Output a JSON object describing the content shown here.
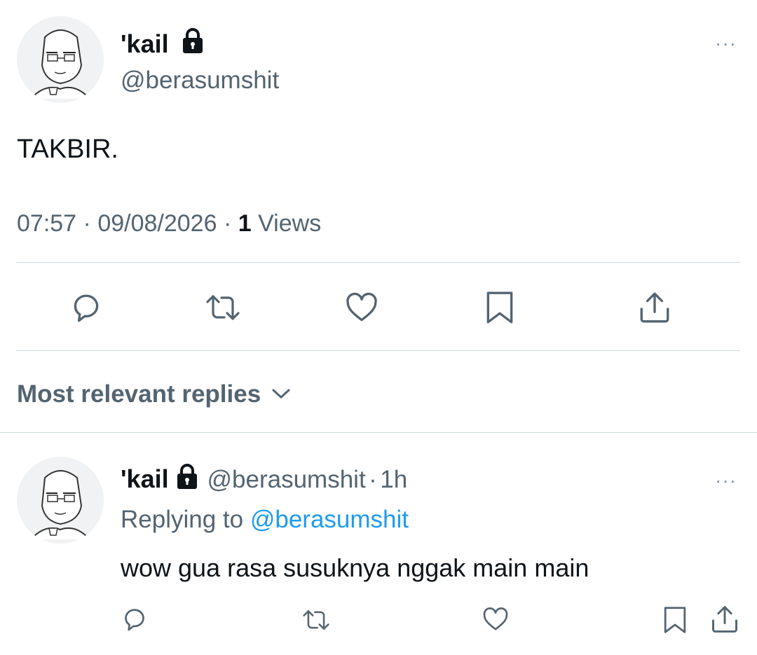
{
  "tweet": {
    "display_name": "'kail",
    "handle": "@berasumshit",
    "text": "TAKBIR.",
    "time": "07:57",
    "date": "09/08/2026",
    "views_count": "1",
    "views_label": "Views",
    "separator": "·",
    "more": "···"
  },
  "replies_sort": {
    "label": "Most relevant replies"
  },
  "reply": {
    "display_name": "'kail",
    "handle": "@berasumshit",
    "age": "1h",
    "separator": "·",
    "replying_prefix": "Replying to",
    "replying_handle": "@berasumshit",
    "text": "wow gua rasa susuknya nggak main main",
    "more": "···"
  },
  "colors": {
    "accent": "#1d9bf0",
    "secondary_text": "#536471",
    "divider": "#cfd9de"
  },
  "icons": [
    "lock-icon",
    "more-icon",
    "reply-icon",
    "retweet-icon",
    "like-icon",
    "bookmark-icon",
    "share-icon",
    "chevron-down-icon"
  ]
}
